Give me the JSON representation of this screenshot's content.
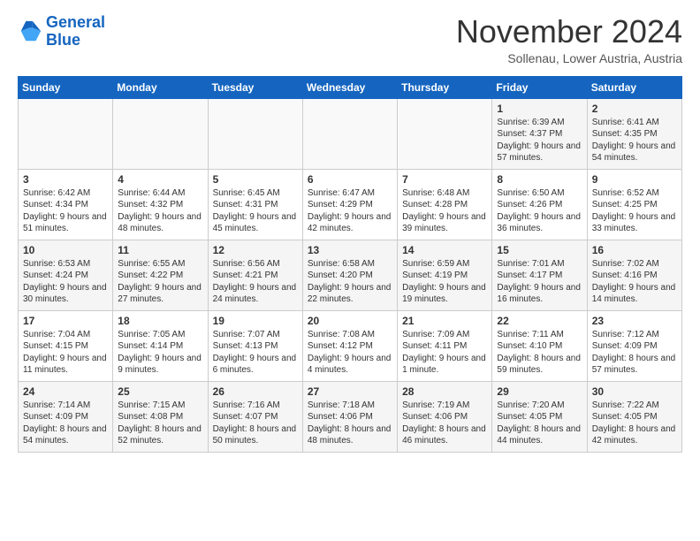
{
  "logo": {
    "line1": "General",
    "line2": "Blue"
  },
  "title": "November 2024",
  "subtitle": "Sollenau, Lower Austria, Austria",
  "days_header": [
    "Sunday",
    "Monday",
    "Tuesday",
    "Wednesday",
    "Thursday",
    "Friday",
    "Saturday"
  ],
  "weeks": [
    [
      {
        "day": "",
        "text": ""
      },
      {
        "day": "",
        "text": ""
      },
      {
        "day": "",
        "text": ""
      },
      {
        "day": "",
        "text": ""
      },
      {
        "day": "",
        "text": ""
      },
      {
        "day": "1",
        "text": "Sunrise: 6:39 AM\nSunset: 4:37 PM\nDaylight: 9 hours and 57 minutes."
      },
      {
        "day": "2",
        "text": "Sunrise: 6:41 AM\nSunset: 4:35 PM\nDaylight: 9 hours and 54 minutes."
      }
    ],
    [
      {
        "day": "3",
        "text": "Sunrise: 6:42 AM\nSunset: 4:34 PM\nDaylight: 9 hours and 51 minutes."
      },
      {
        "day": "4",
        "text": "Sunrise: 6:44 AM\nSunset: 4:32 PM\nDaylight: 9 hours and 48 minutes."
      },
      {
        "day": "5",
        "text": "Sunrise: 6:45 AM\nSunset: 4:31 PM\nDaylight: 9 hours and 45 minutes."
      },
      {
        "day": "6",
        "text": "Sunrise: 6:47 AM\nSunset: 4:29 PM\nDaylight: 9 hours and 42 minutes."
      },
      {
        "day": "7",
        "text": "Sunrise: 6:48 AM\nSunset: 4:28 PM\nDaylight: 9 hours and 39 minutes."
      },
      {
        "day": "8",
        "text": "Sunrise: 6:50 AM\nSunset: 4:26 PM\nDaylight: 9 hours and 36 minutes."
      },
      {
        "day": "9",
        "text": "Sunrise: 6:52 AM\nSunset: 4:25 PM\nDaylight: 9 hours and 33 minutes."
      }
    ],
    [
      {
        "day": "10",
        "text": "Sunrise: 6:53 AM\nSunset: 4:24 PM\nDaylight: 9 hours and 30 minutes."
      },
      {
        "day": "11",
        "text": "Sunrise: 6:55 AM\nSunset: 4:22 PM\nDaylight: 9 hours and 27 minutes."
      },
      {
        "day": "12",
        "text": "Sunrise: 6:56 AM\nSunset: 4:21 PM\nDaylight: 9 hours and 24 minutes."
      },
      {
        "day": "13",
        "text": "Sunrise: 6:58 AM\nSunset: 4:20 PM\nDaylight: 9 hours and 22 minutes."
      },
      {
        "day": "14",
        "text": "Sunrise: 6:59 AM\nSunset: 4:19 PM\nDaylight: 9 hours and 19 minutes."
      },
      {
        "day": "15",
        "text": "Sunrise: 7:01 AM\nSunset: 4:17 PM\nDaylight: 9 hours and 16 minutes."
      },
      {
        "day": "16",
        "text": "Sunrise: 7:02 AM\nSunset: 4:16 PM\nDaylight: 9 hours and 14 minutes."
      }
    ],
    [
      {
        "day": "17",
        "text": "Sunrise: 7:04 AM\nSunset: 4:15 PM\nDaylight: 9 hours and 11 minutes."
      },
      {
        "day": "18",
        "text": "Sunrise: 7:05 AM\nSunset: 4:14 PM\nDaylight: 9 hours and 9 minutes."
      },
      {
        "day": "19",
        "text": "Sunrise: 7:07 AM\nSunset: 4:13 PM\nDaylight: 9 hours and 6 minutes."
      },
      {
        "day": "20",
        "text": "Sunrise: 7:08 AM\nSunset: 4:12 PM\nDaylight: 9 hours and 4 minutes."
      },
      {
        "day": "21",
        "text": "Sunrise: 7:09 AM\nSunset: 4:11 PM\nDaylight: 9 hours and 1 minute."
      },
      {
        "day": "22",
        "text": "Sunrise: 7:11 AM\nSunset: 4:10 PM\nDaylight: 8 hours and 59 minutes."
      },
      {
        "day": "23",
        "text": "Sunrise: 7:12 AM\nSunset: 4:09 PM\nDaylight: 8 hours and 57 minutes."
      }
    ],
    [
      {
        "day": "24",
        "text": "Sunrise: 7:14 AM\nSunset: 4:09 PM\nDaylight: 8 hours and 54 minutes."
      },
      {
        "day": "25",
        "text": "Sunrise: 7:15 AM\nSunset: 4:08 PM\nDaylight: 8 hours and 52 minutes."
      },
      {
        "day": "26",
        "text": "Sunrise: 7:16 AM\nSunset: 4:07 PM\nDaylight: 8 hours and 50 minutes."
      },
      {
        "day": "27",
        "text": "Sunrise: 7:18 AM\nSunset: 4:06 PM\nDaylight: 8 hours and 48 minutes."
      },
      {
        "day": "28",
        "text": "Sunrise: 7:19 AM\nSunset: 4:06 PM\nDaylight: 8 hours and 46 minutes."
      },
      {
        "day": "29",
        "text": "Sunrise: 7:20 AM\nSunset: 4:05 PM\nDaylight: 8 hours and 44 minutes."
      },
      {
        "day": "30",
        "text": "Sunrise: 7:22 AM\nSunset: 4:05 PM\nDaylight: 8 hours and 42 minutes."
      }
    ]
  ]
}
